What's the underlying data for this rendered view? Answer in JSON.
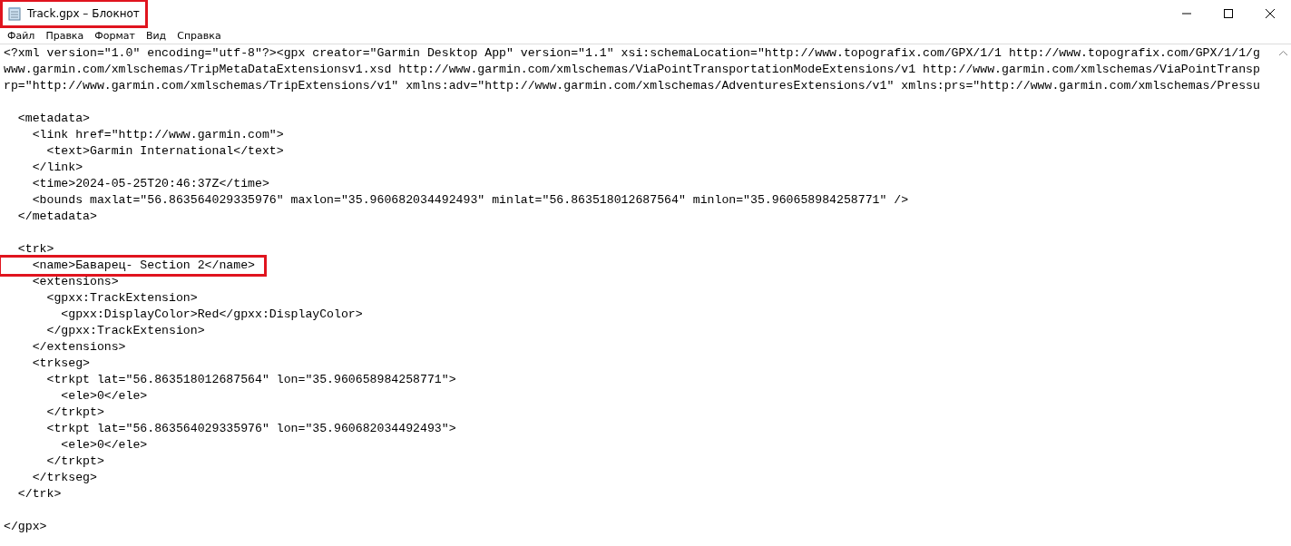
{
  "window": {
    "title": "Track.gpx – Блокнот",
    "highlighted": true
  },
  "menu": [
    "Файл",
    "Правка",
    "Формат",
    "Вид",
    "Справка"
  ],
  "blocks": [
    {
      "lines": [
        {
          "text": "<?xml version=\"1.0\" encoding=\"utf-8\"?><gpx creator=\"Garmin Desktop App\" version=\"1.1\" xsi:schemaLocation=\"http://www.topografix.com/GPX/1/1 http://www.topografix.com/GPX/1/1/g",
          "highlighted": false
        },
        {
          "text": "www.garmin.com/xmlschemas/TripMetaDataExtensionsv1.xsd http://www.garmin.com/xmlschemas/ViaPointTransportationModeExtensions/v1 http://www.garmin.com/xmlschemas/ViaPointTransp",
          "highlighted": false
        },
        {
          "text": "rp=\"http://www.garmin.com/xmlschemas/TripExtensions/v1\" xmlns:adv=\"http://www.garmin.com/xmlschemas/AdventuresExtensions/v1\" xmlns:prs=\"http://www.garmin.com/xmlschemas/Pressu",
          "highlighted": false
        }
      ]
    },
    {
      "lines": [
        {
          "text": "  <metadata>",
          "highlighted": false
        },
        {
          "text": "    <link href=\"http://www.garmin.com\">",
          "highlighted": false
        },
        {
          "text": "      <text>Garmin International</text>",
          "highlighted": false
        },
        {
          "text": "    </link>",
          "highlighted": false
        },
        {
          "text": "    <time>2024-05-25T20:46:37Z</time>",
          "highlighted": false
        },
        {
          "text": "    <bounds maxlat=\"56.863564029335976\" maxlon=\"35.960682034492493\" minlat=\"56.863518012687564\" minlon=\"35.960658984258771\" />",
          "highlighted": false
        },
        {
          "text": "  </metadata>",
          "highlighted": false
        }
      ]
    },
    {
      "lines": [
        {
          "text": "  <trk>",
          "highlighted": false
        },
        {
          "text": "    <name>Баварец- Section 2</name>",
          "highlighted": true
        },
        {
          "text": "    <extensions>",
          "highlighted": false
        },
        {
          "text": "      <gpxx:TrackExtension>",
          "highlighted": false
        },
        {
          "text": "        <gpxx:DisplayColor>Red</gpxx:DisplayColor>",
          "highlighted": false
        },
        {
          "text": "      </gpxx:TrackExtension>",
          "highlighted": false
        },
        {
          "text": "    </extensions>",
          "highlighted": false
        },
        {
          "text": "    <trkseg>",
          "highlighted": false
        },
        {
          "text": "      <trkpt lat=\"56.863518012687564\" lon=\"35.960658984258771\">",
          "highlighted": false
        },
        {
          "text": "        <ele>0</ele>",
          "highlighted": false
        },
        {
          "text": "      </trkpt>",
          "highlighted": false
        },
        {
          "text": "      <trkpt lat=\"56.863564029335976\" lon=\"35.960682034492493\">",
          "highlighted": false
        },
        {
          "text": "        <ele>0</ele>",
          "highlighted": false
        },
        {
          "text": "      </trkpt>",
          "highlighted": false
        },
        {
          "text": "    </trkseg>",
          "highlighted": false
        },
        {
          "text": "  </trk>",
          "highlighted": false
        }
      ]
    },
    {
      "lines": [
        {
          "text": "</gpx>",
          "highlighted": false
        }
      ]
    }
  ]
}
